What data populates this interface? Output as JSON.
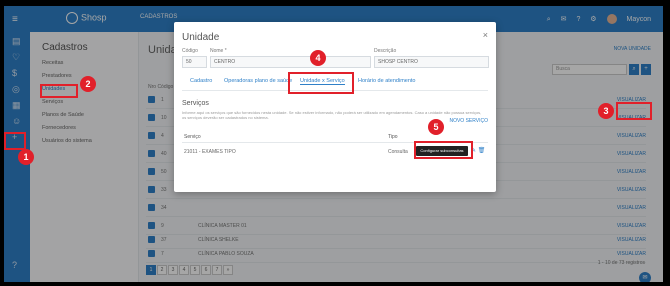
{
  "app": {
    "logo": "Shosp",
    "user": "Maycon"
  },
  "sidebar": {
    "title": "Cadastros",
    "items": [
      "Receitas",
      "Prestadores",
      "Unidades",
      "Serviços",
      "Planos de Saúde",
      "Fornecedores",
      "Usuários do sistema"
    ]
  },
  "topbar": {
    "tab": "CADASTROS"
  },
  "page": {
    "title": "Unidades",
    "new_link": "NOVA UNIDADE",
    "search_placeholder": "Busca",
    "table_head": "Nro Código",
    "visualize": "VISUALIZAR",
    "rows": [
      {
        "num": "1",
        "name": ""
      },
      {
        "num": "10",
        "name": ""
      },
      {
        "num": "4",
        "name": ""
      },
      {
        "num": "40",
        "name": ""
      },
      {
        "num": "50",
        "name": ""
      },
      {
        "num": "33",
        "name": ""
      },
      {
        "num": "34",
        "name": ""
      },
      {
        "num": "9",
        "name": "CLÍNICA MASTER 01"
      },
      {
        "num": "37",
        "name": "CLÍNICA SHELKE"
      },
      {
        "num": "7",
        "name": "CLÍNICA PABLO SOUZA"
      }
    ],
    "pages": [
      "1",
      "2",
      "3",
      "4",
      "5",
      "6",
      "7",
      "»"
    ],
    "page_info": "1 - 10 de 73 registros"
  },
  "modal": {
    "title": "Unidade",
    "code_label": "Código",
    "code_value": "50",
    "name_label": "Nome *",
    "name_value": "CENTRO",
    "desc_label": "Descrição",
    "desc_value": "SHOSP CENTRO",
    "tabs": [
      "Cadastro",
      "Operadoras plano de saúde",
      "Unidade x Serviço",
      "Horário de atendimento"
    ],
    "section_title": "Serviços",
    "section_desc": "Informe aqui os serviços que são fornecidos nesta unidade. Se não estiver informado, não poderá ser utilizado em agendamentos. Caso a unidade não possua serviços, os serviços deverão ser cadastrados no sistema.",
    "new_service": "NOVO SERVIÇO",
    "col_service": "Serviço",
    "col_type": "Tipo",
    "service_row": {
      "name": "21011 - EXAMES TIPO",
      "type": "Consulta"
    },
    "tooltip": "Configurar subconsultas"
  },
  "callouts": [
    "1",
    "2",
    "3",
    "4",
    "5"
  ],
  "colors": {
    "accent": "#2f80c8",
    "highlight": "#e1202a"
  }
}
